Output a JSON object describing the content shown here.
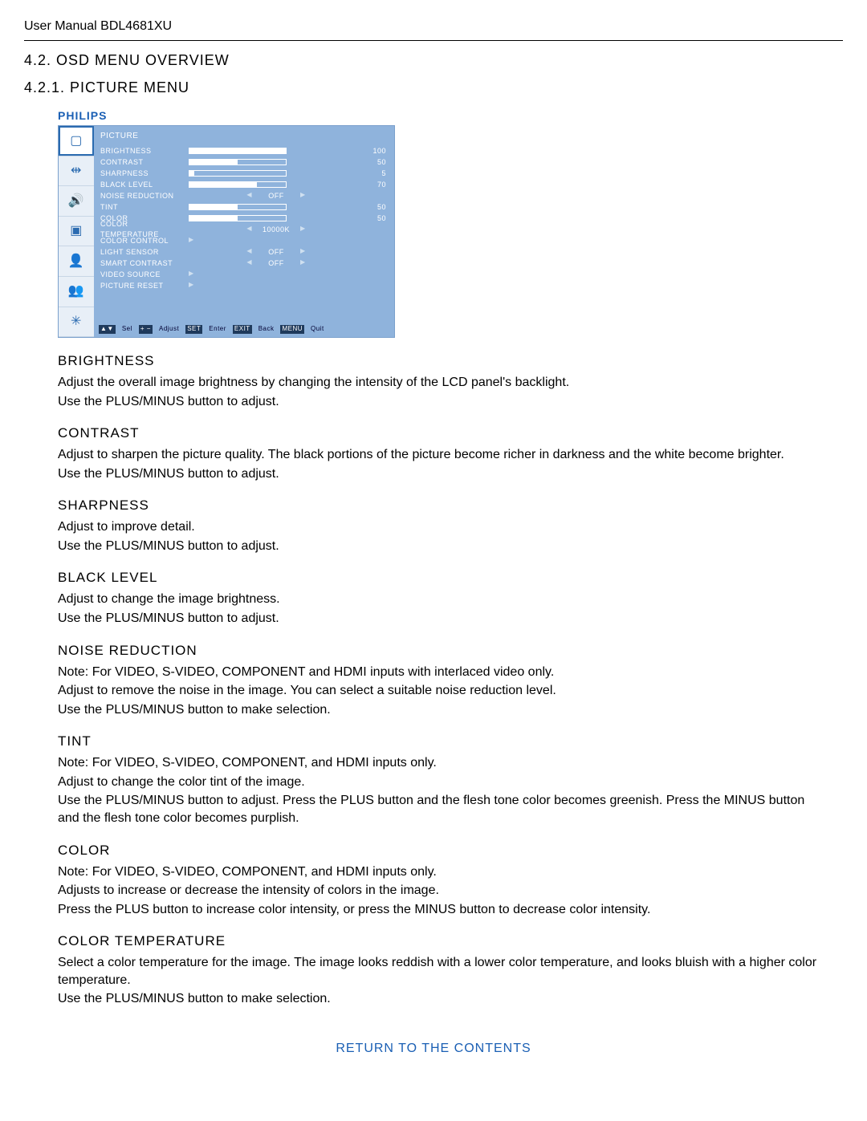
{
  "header": "User Manual BDL4681XU",
  "section_num_title": "4.2.    OSD MENU OVERVIEW",
  "subsection_num_title": "4.2.1.    PICTURE MENU",
  "osd": {
    "brand": "PHILIPS",
    "title": "PICTURE",
    "rows": [
      {
        "label": "BRIGHTNESS",
        "type": "bar",
        "value": 100,
        "max": 100
      },
      {
        "label": "CONTRAST",
        "type": "bar",
        "value": 50,
        "max": 100
      },
      {
        "label": "SHARPNESS",
        "type": "bar",
        "value": 5,
        "max": 100
      },
      {
        "label": "BLACK LEVEL",
        "type": "bar",
        "value": 70,
        "max": 100
      },
      {
        "label": "NOISE REDUCTION",
        "type": "sel",
        "selValue": "OFF"
      },
      {
        "label": "TINT",
        "type": "bar",
        "value": 50,
        "max": 100
      },
      {
        "label": "COLOR",
        "type": "bar",
        "value": 50,
        "max": 100
      },
      {
        "label": "COLOR TEMPERATURE",
        "type": "sel",
        "selValue": "10000K"
      },
      {
        "label": "COLOR CONTROL",
        "type": "link"
      },
      {
        "label": "LIGHT SENSOR",
        "type": "sel",
        "selValue": "OFF"
      },
      {
        "label": "SMART CONTRAST",
        "type": "sel",
        "selValue": "OFF"
      },
      {
        "label": "VIDEO SOURCE",
        "type": "link"
      },
      {
        "label": "PICTURE RESET",
        "type": "link"
      }
    ],
    "hints": {
      "sel": "Sel",
      "adjust": "Adjust",
      "set": "SET",
      "enter": "Enter",
      "exit": "EXIT",
      "back": "Back",
      "menu": "MENU",
      "quit": "Quit"
    }
  },
  "items": [
    {
      "title": "BRIGHTNESS",
      "paras": [
        "Adjust the overall image brightness by changing the intensity of the LCD panel's backlight.",
        "Use the PLUS/MINUS button to adjust."
      ]
    },
    {
      "title": "CONTRAST",
      "paras": [
        "Adjust to sharpen the picture quality. The black portions of the picture become richer in darkness and the white become brighter.",
        "Use the PLUS/MINUS button to adjust."
      ]
    },
    {
      "title": "SHARPNESS",
      "paras": [
        "Adjust to improve detail.",
        "Use the PLUS/MINUS button to adjust."
      ]
    },
    {
      "title": "BLACK LEVEL",
      "paras": [
        "Adjust to change the image brightness.",
        "Use the PLUS/MINUS button to adjust."
      ]
    },
    {
      "title": "NOISE REDUCTION",
      "paras": [
        "Note: For VIDEO, S-VIDEO, COMPONENT and HDMI inputs with interlaced video only.",
        "Adjust to remove the noise in the image. You can select a suitable noise reduction level.",
        "Use the PLUS/MINUS button to make selection."
      ]
    },
    {
      "title": "TINT",
      "paras": [
        "Note: For VIDEO, S-VIDEO, COMPONENT, and HDMI inputs only.",
        "Adjust to change the color tint of the image.",
        "Use the PLUS/MINUS button to adjust. Press the PLUS button and the flesh tone color becomes greenish. Press the MINUS button and the flesh tone color becomes purplish."
      ]
    },
    {
      "title": "COLOR",
      "paras": [
        "Note: For VIDEO, S-VIDEO, COMPONENT, and HDMI inputs only.",
        "Adjusts to increase or decrease the intensity of colors in the image.",
        "Press the PLUS button to increase color intensity, or press the MINUS button to decrease color intensity."
      ]
    },
    {
      "title": "COLOR TEMPERATURE",
      "paras": [
        "Select a color temperature for the image. The image looks reddish with a lower color temperature, and looks bluish with a higher color temperature.",
        "Use the PLUS/MINUS button to make selection."
      ]
    }
  ],
  "return_link": "RETURN TO THE CONTENTS"
}
